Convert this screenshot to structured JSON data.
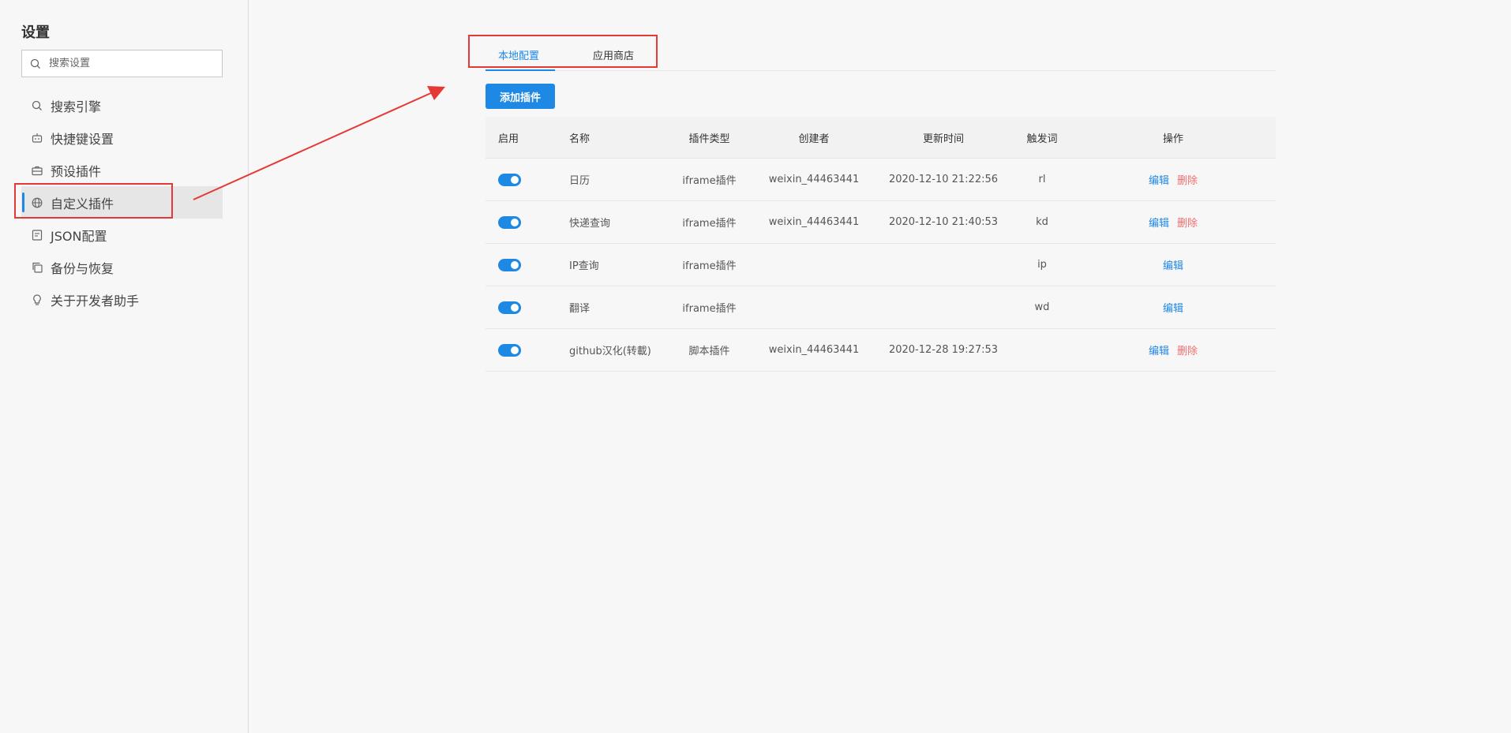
{
  "sidebar": {
    "title": "设置",
    "search_placeholder": "搜索设置",
    "items": [
      {
        "label": "搜索引擎",
        "icon": "search-icon"
      },
      {
        "label": "快捷键设置",
        "icon": "robot-icon"
      },
      {
        "label": "预设插件",
        "icon": "briefcase-icon"
      },
      {
        "label": "自定义插件",
        "icon": "globe-icon"
      },
      {
        "label": "JSON配置",
        "icon": "document-icon"
      },
      {
        "label": "备份与恢复",
        "icon": "copy-icon"
      },
      {
        "label": "关于开发者助手",
        "icon": "lightbulb-icon"
      }
    ]
  },
  "tabs": [
    {
      "label": "本地配置"
    },
    {
      "label": "应用商店"
    }
  ],
  "add_button": "添加插件",
  "table": {
    "headers": [
      "启用",
      "名称",
      "插件类型",
      "创建者",
      "更新时间",
      "触发词",
      "操作"
    ],
    "rows": [
      {
        "name": "日历",
        "type": "iframe插件",
        "creator": "weixin_44463441",
        "time": "2020-12-10 21:22:56",
        "trigger": "rl",
        "edit": "编辑",
        "delete": "删除"
      },
      {
        "name": "快递查询",
        "type": "iframe插件",
        "creator": "weixin_44463441",
        "time": "2020-12-10 21:40:53",
        "trigger": "kd",
        "edit": "编辑",
        "delete": "删除"
      },
      {
        "name": "IP查询",
        "type": "iframe插件",
        "creator": "",
        "time": "",
        "trigger": "ip",
        "edit": "编辑",
        "delete": ""
      },
      {
        "name": "翻译",
        "type": "iframe插件",
        "creator": "",
        "time": "",
        "trigger": "wd",
        "edit": "编辑",
        "delete": ""
      },
      {
        "name": "github汉化(转載)",
        "type": "脚本插件",
        "creator": "weixin_44463441",
        "time": "2020-12-28 19:27:53",
        "trigger": "",
        "edit": "编辑",
        "delete": "删除"
      }
    ]
  },
  "colors": {
    "accent": "#1e88e5",
    "danger": "#f56c6c",
    "annotation": "#e53935"
  }
}
